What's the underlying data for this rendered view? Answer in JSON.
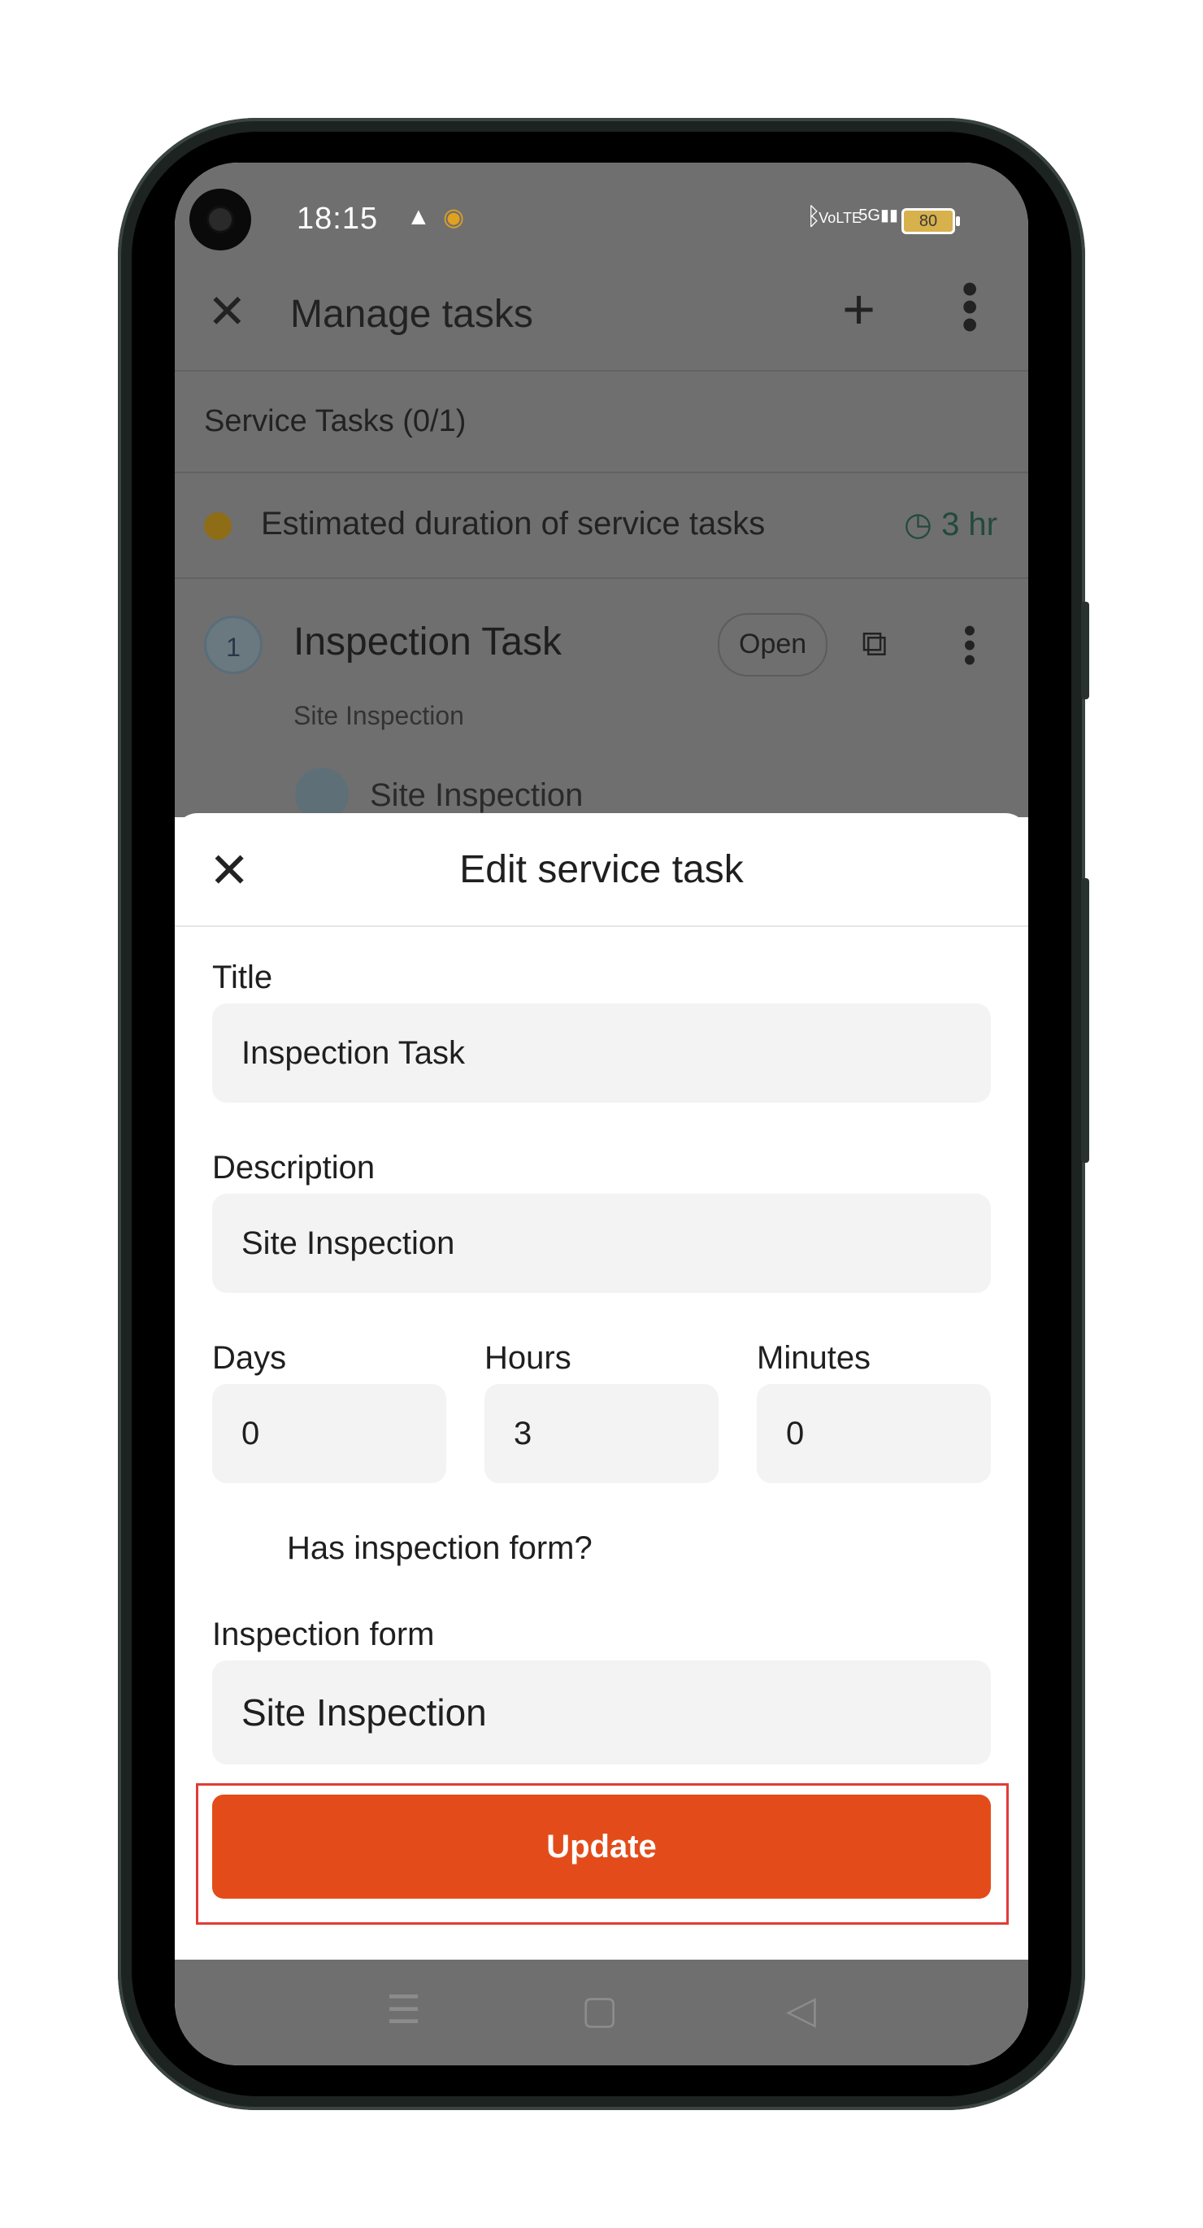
{
  "status_bar": {
    "time": "18:15",
    "battery": "80",
    "network": "5G"
  },
  "background_screen": {
    "title": "Manage tasks",
    "section_header": "Service Tasks (0/1)",
    "estimate_label": "Estimated duration of service tasks",
    "estimate_value": "3 hr",
    "task": {
      "number": "1",
      "title": "Inspection Task",
      "status": "Open",
      "subtitle": "Site Inspection",
      "form_name": "Site Inspection"
    }
  },
  "sheet": {
    "title": "Edit service task",
    "title_label": "Title",
    "title_value": "Inspection Task",
    "description_label": "Description",
    "description_value": "Site Inspection",
    "days_label": "Days",
    "days_value": "0",
    "hours_label": "Hours",
    "hours_value": "3",
    "minutes_label": "Minutes",
    "minutes_value": "0",
    "has_form_label": "Has inspection form?",
    "has_form_checked": true,
    "inspection_form_label": "Inspection form",
    "inspection_form_value": "Site Inspection",
    "update_label": "Update"
  },
  "colors": {
    "accent": "#e34c1a",
    "checkbox": "#1c2a83",
    "highlight": "#e23b36"
  },
  "icons": [
    "close-icon",
    "plus-icon",
    "more-vert-icon",
    "clock-icon",
    "copy-icon",
    "document-icon",
    "check-icon",
    "menu-nav-icon",
    "home-nav-icon",
    "back-nav-icon",
    "bluetooth-icon",
    "signal-icon",
    "battery-icon"
  ]
}
